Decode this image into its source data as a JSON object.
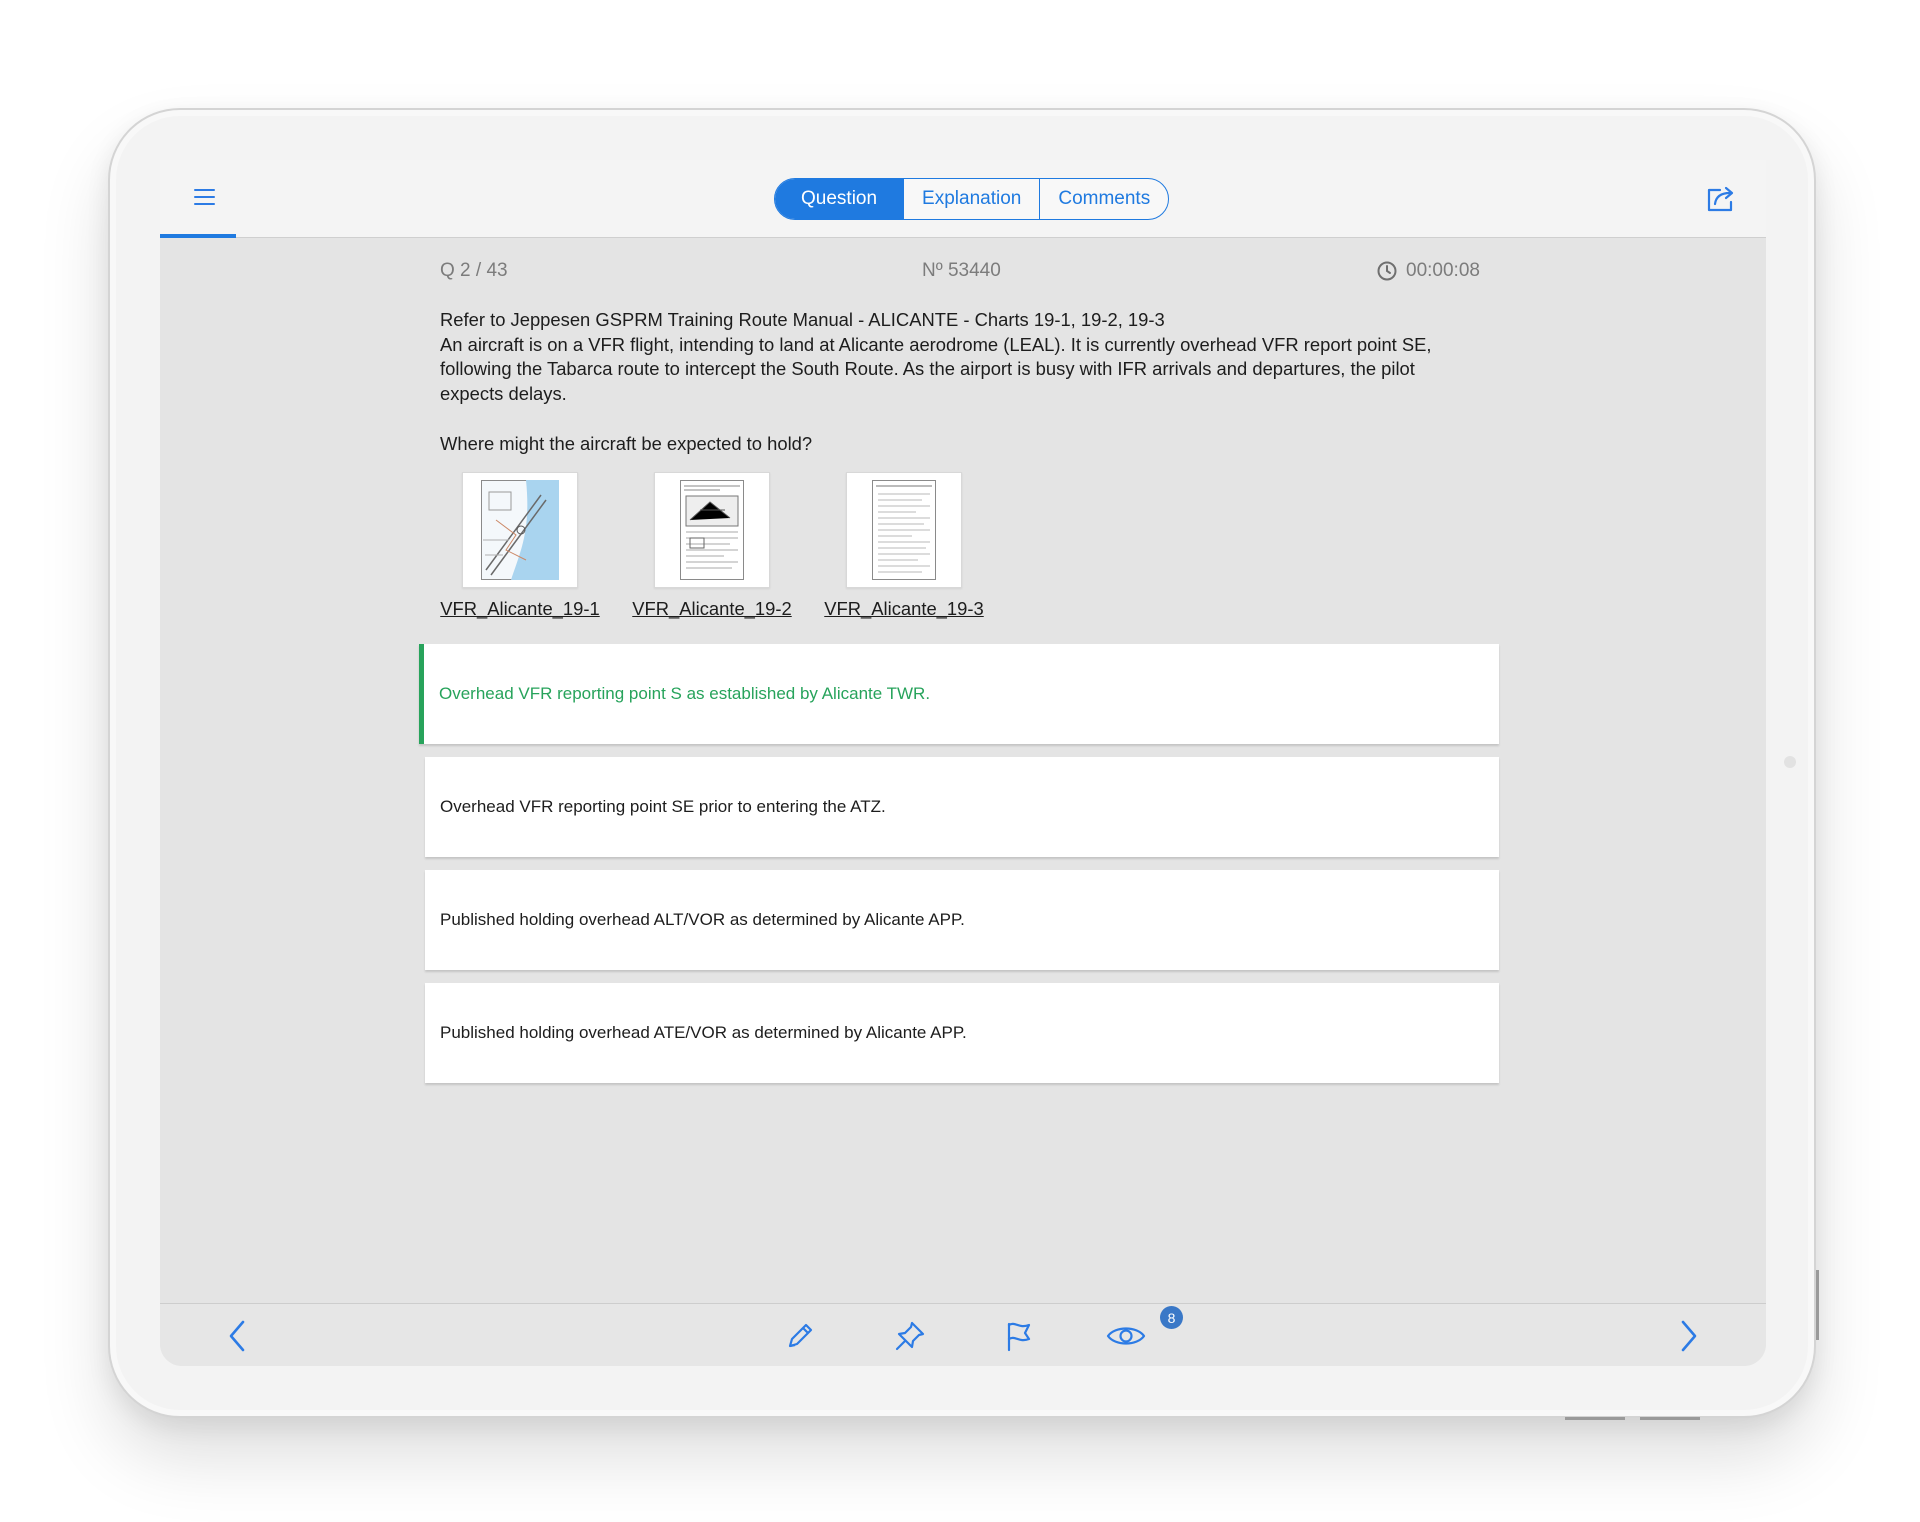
{
  "header": {
    "tabs": [
      {
        "label": "Question",
        "active": true
      },
      {
        "label": "Explanation",
        "active": false
      },
      {
        "label": "Comments",
        "active": false
      }
    ],
    "menu_icon": "hamburger-menu-icon",
    "share_icon": "share-icon"
  },
  "meta": {
    "question_position": "Q  2 / 43",
    "question_number": "Nº 53440",
    "timer": "00:00:08",
    "timer_icon": "clock-icon"
  },
  "question": {
    "stem_line1": "Refer to Jeppesen GSPRM Training Route Manual - ALICANTE - Charts 19-1, 19-2, 19-3",
    "stem_line2": "An aircraft is on a VFR flight, intending to land at Alicante aerodrome (LEAL). It is currently overhead VFR report point SE, following the Tabarca route to intercept the South Route. As the airport is busy with IFR arrivals and departures, the pilot expects delays.",
    "prompt": "Where might the aircraft be expected to hold?"
  },
  "attachments": [
    {
      "label": "VFR_Alicante_19-1"
    },
    {
      "label": "VFR_Alicante_19-2"
    },
    {
      "label": "VFR_Alicante_19-3"
    }
  ],
  "answers": [
    {
      "text": "Overhead VFR reporting point S as established by Alicante TWR.",
      "correct": true
    },
    {
      "text": "Overhead VFR reporting point SE prior to entering the ATZ.",
      "correct": false
    },
    {
      "text": "Published holding overhead ALT/VOR as determined by Alicante APP.",
      "correct": false
    },
    {
      "text": "Published holding overhead ATE/VOR as determined by Alicante APP.",
      "correct": false
    }
  ],
  "toolbar": {
    "prev_icon": "chevron-left-icon",
    "edit_icon": "pencil-icon",
    "pin_icon": "pin-icon",
    "flag_icon": "flag-icon",
    "eye_icon": "eye-icon",
    "eye_badge": "8",
    "next_icon": "chevron-right-icon"
  },
  "colors": {
    "accent": "#1f7ae0",
    "correct": "#27a35b",
    "badge": "#3a78c7"
  }
}
